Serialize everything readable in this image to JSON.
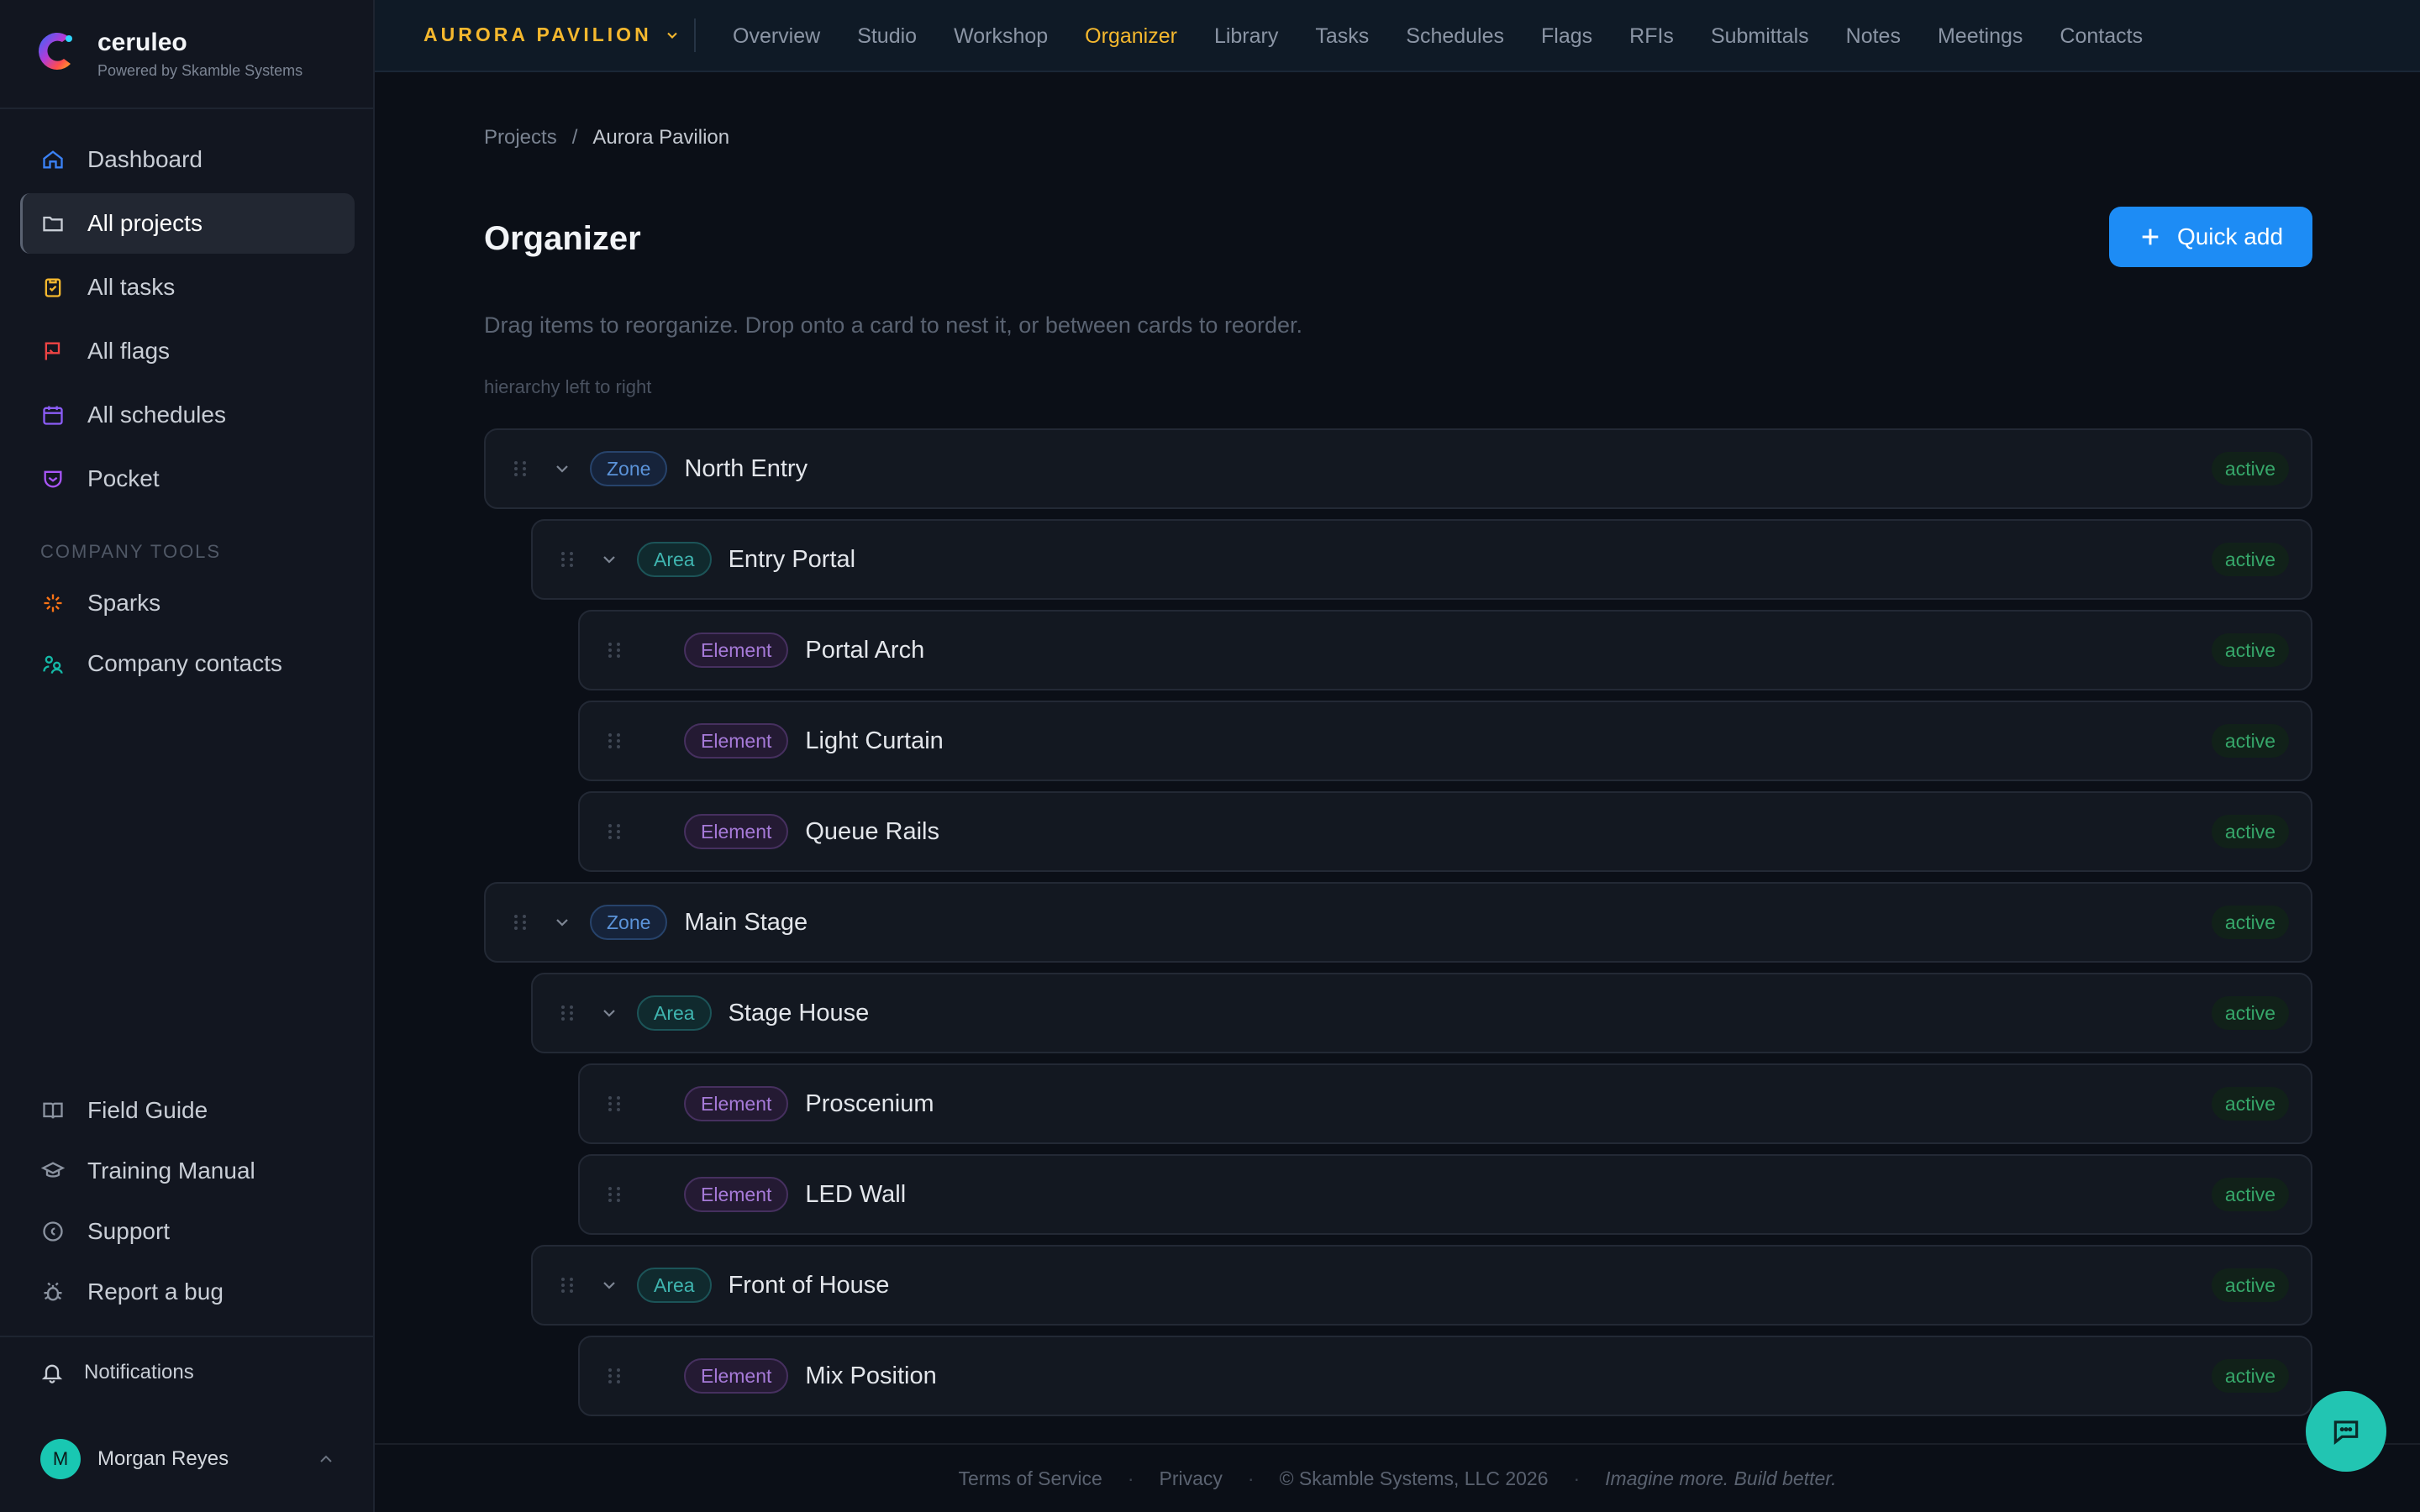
{
  "brand": {
    "name": "ceruleo",
    "tagline": "Powered by Skamble Systems"
  },
  "sidebar": {
    "items": [
      {
        "label": "Dashboard",
        "icon": "home-icon",
        "color": "#3b82f6"
      },
      {
        "label": "All projects",
        "icon": "folder-icon",
        "color": "#c9ced6",
        "active": true
      },
      {
        "label": "All tasks",
        "icon": "clipboard-icon",
        "color": "#f5b82e"
      },
      {
        "label": "All flags",
        "icon": "flag-icon",
        "color": "#ef4444"
      },
      {
        "label": "All schedules",
        "icon": "calendar-icon",
        "color": "#8b5cf6"
      },
      {
        "label": "Pocket",
        "icon": "pocket-icon",
        "color": "#a855f7"
      }
    ],
    "section_label": "COMPANY TOOLS",
    "tools": [
      {
        "label": "Sparks",
        "icon": "sparks-icon",
        "color": "#f97316"
      },
      {
        "label": "Company contacts",
        "icon": "contacts-icon",
        "color": "#14b8a6"
      }
    ],
    "help": [
      {
        "label": "Field Guide",
        "icon": "book-icon"
      },
      {
        "label": "Training Manual",
        "icon": "graduation-icon"
      },
      {
        "label": "Support",
        "icon": "support-icon"
      },
      {
        "label": "Report a bug",
        "icon": "bug-icon"
      }
    ],
    "notifications_label": "Notifications",
    "user": {
      "initial": "M",
      "name": "Morgan Reyes"
    }
  },
  "topbar": {
    "project": "AURORA PAVILION",
    "tabs": [
      "Overview",
      "Studio",
      "Workshop",
      "Organizer",
      "Library",
      "Tasks",
      "Schedules",
      "Flags",
      "RFIs",
      "Submittals",
      "Notes",
      "Meetings",
      "Contacts"
    ],
    "active_tab": "Organizer"
  },
  "breadcrumb": {
    "root": "Projects",
    "separator": "/",
    "current": "Aurora Pavilion"
  },
  "page": {
    "title": "Organizer",
    "quick_add_label": "Quick add",
    "hint": "Drag items to reorganize. Drop onto a card to nest it, or between cards to reorder.",
    "hierarchy_note": "hierarchy left to right"
  },
  "tree": [
    {
      "level": 0,
      "type": "Zone",
      "title": "North Entry",
      "status": "active",
      "expandable": true
    },
    {
      "level": 1,
      "type": "Area",
      "title": "Entry Portal",
      "status": "active",
      "expandable": true
    },
    {
      "level": 2,
      "type": "Element",
      "title": "Portal Arch",
      "status": "active",
      "expandable": false
    },
    {
      "level": 2,
      "type": "Element",
      "title": "Light Curtain",
      "status": "active",
      "expandable": false
    },
    {
      "level": 2,
      "type": "Element",
      "title": "Queue Rails",
      "status": "active",
      "expandable": false
    },
    {
      "level": 0,
      "type": "Zone",
      "title": "Main Stage",
      "status": "active",
      "expandable": true
    },
    {
      "level": 1,
      "type": "Area",
      "title": "Stage House",
      "status": "active",
      "expandable": true
    },
    {
      "level": 2,
      "type": "Element",
      "title": "Proscenium",
      "status": "active",
      "expandable": false
    },
    {
      "level": 2,
      "type": "Element",
      "title": "LED Wall",
      "status": "active",
      "expandable": false
    },
    {
      "level": 1,
      "type": "Area",
      "title": "Front of House",
      "status": "active",
      "expandable": true
    },
    {
      "level": 2,
      "type": "Element",
      "title": "Mix Position",
      "status": "active",
      "expandable": false
    }
  ],
  "footer": {
    "terms": "Terms of Service",
    "privacy": "Privacy",
    "copyright": "© Skamble Systems, LLC 2026",
    "tagline": "Imagine more. Build better."
  },
  "chat": {
    "icon": "chat-bubble-icon"
  }
}
